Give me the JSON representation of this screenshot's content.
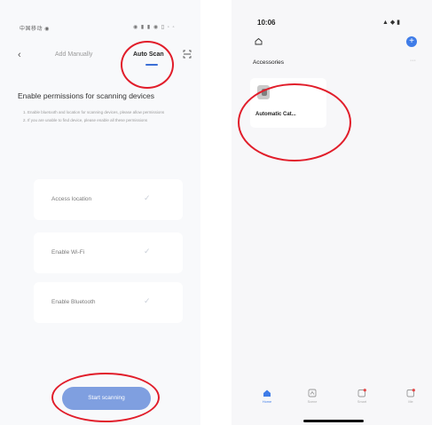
{
  "left_screen": {
    "status_bar": {
      "left": "中国移动 ◉",
      "right": "◉ ▮ ▮ ◉ ▯ ◦ ◦"
    },
    "header": {
      "back_icon": "chevron-left-icon",
      "tab_manual": "Add Manually",
      "tab_auto": "Auto Scan",
      "scan_icon": "scan-frame-icon"
    },
    "permissions": {
      "title": "Enable permissions for scanning devices",
      "desc_1": "1. Enable bluetooth and location for scanning devices, please allow permissions",
      "desc_2": "2. If you are unable to find device, please enable all these permissions"
    },
    "items": [
      {
        "label": "Access location"
      },
      {
        "label": "Enable Wi-Fi"
      },
      {
        "label": "Enable Bluetooth"
      }
    ],
    "start_button": "Start scanning"
  },
  "right_screen": {
    "status_bar": {
      "time": "10:06",
      "right": "▲ ◆ ▮"
    },
    "home_icon": "home-outline-icon",
    "plus_icon": "plus-icon",
    "accessories_label": "Accessories",
    "accessories_more": "···",
    "device": {
      "name": "Automatic Cat..."
    },
    "tabs": [
      {
        "label": "Home",
        "icon": "home-icon"
      },
      {
        "label": "Scene",
        "icon": "scene-icon"
      },
      {
        "label": "Smart",
        "icon": "smart-icon"
      },
      {
        "label": "Me",
        "icon": "me-icon"
      }
    ]
  },
  "colors": {
    "accent": "#3b6fd6",
    "button": "#7f9fe0",
    "annotation": "#e11d2a"
  }
}
